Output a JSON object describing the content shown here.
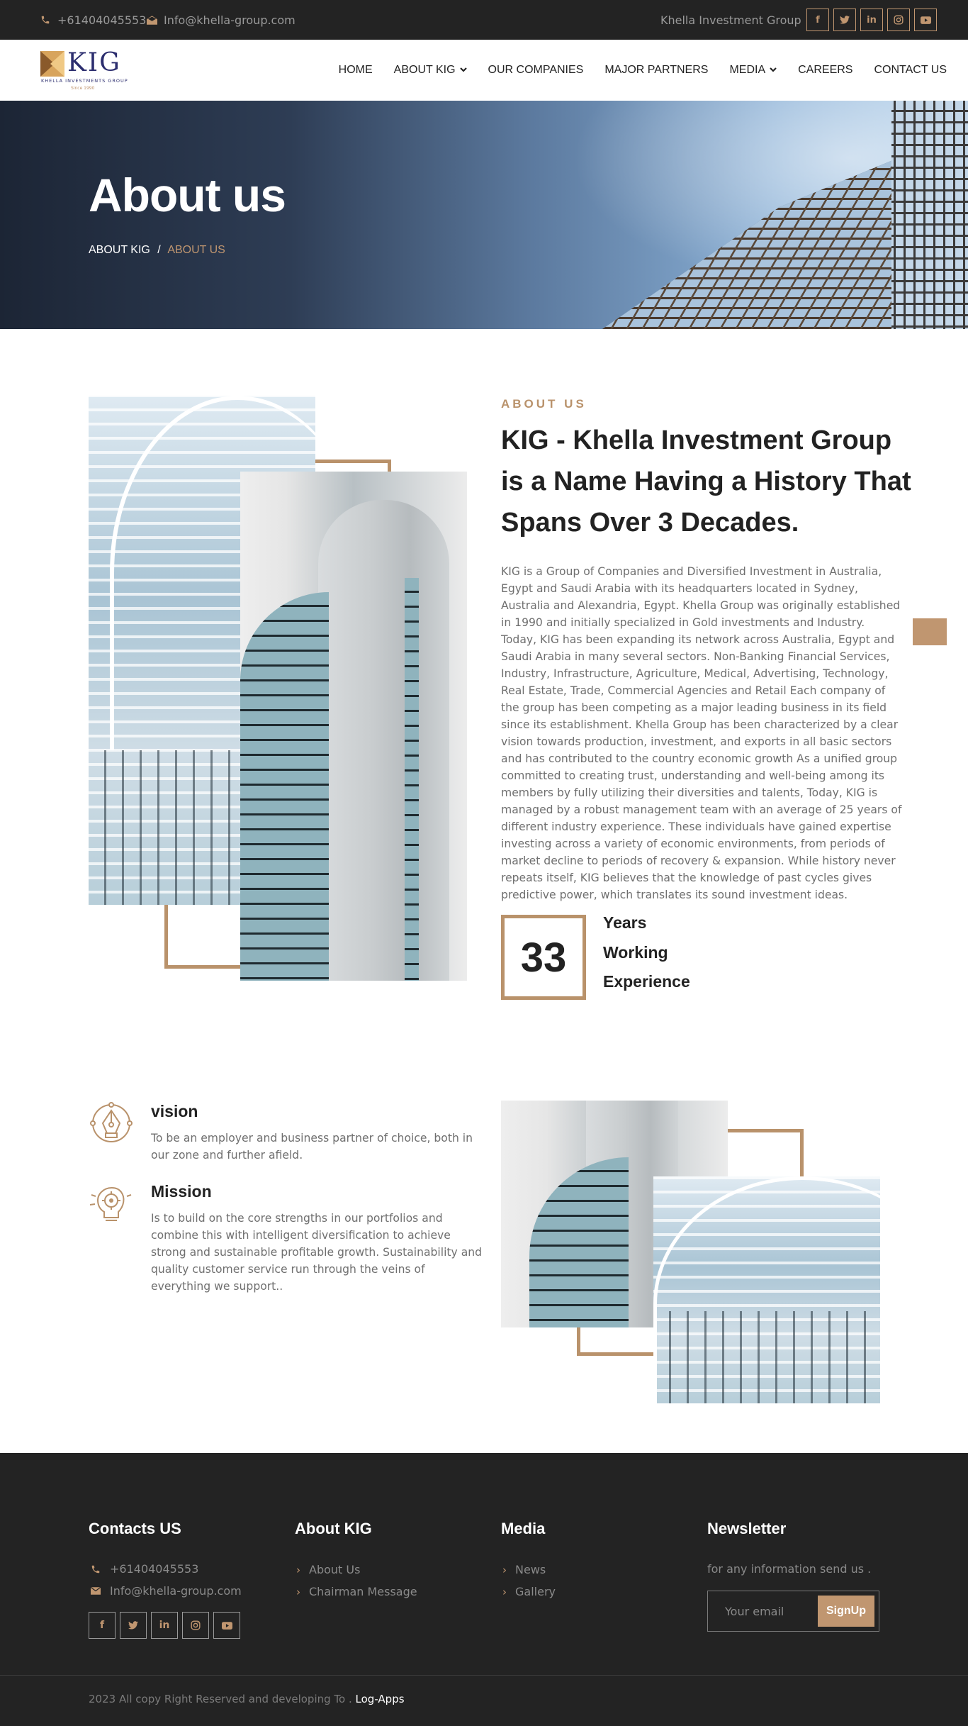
{
  "topbar": {
    "phone": "+61404045553",
    "email": "Info@khella-group.com",
    "brand": "Khella Investment Group"
  },
  "logo": {
    "text": "KIG",
    "subtitle": "KHELLA INVESTMENTS GROUP",
    "since": "Since 1990"
  },
  "nav": {
    "items": [
      "HOME",
      "ABOUT KIG",
      "OUR COMPANIES",
      "MAJOR PARTNERS",
      "MEDIA",
      "CAREERS",
      "CONTACT US"
    ]
  },
  "hero": {
    "title": "About us",
    "crumb_parent": "ABOUT KIG",
    "crumb_sep": "/",
    "crumb_current": "ABOUT US"
  },
  "about": {
    "kicker": "ABOUT US",
    "heading_lines": [
      "KIG - Khella Investment Group",
      "is a Name Having a History That",
      "Spans Over 3 Decades."
    ],
    "paragraph_lines": [
      "KIG is a Group of Companies and Diversified Investment in Australia,",
      "Egypt and Saudi Arabia with its headquarters located in Sydney,",
      "Australia and Alexandria, Egypt. Khella Group was originally established",
      "in 1990 and initially specialized in Gold investments and Industry.",
      "Today, KIG has been expanding its network across Australia, Egypt and",
      "Saudi Arabia in many several sectors. Non-Banking Financial Services,",
      "Industry, Infrastructure, Agriculture, Medical, Advertising, Technology,",
      "Real Estate, Trade, Commercial Agencies and Retail Each company of",
      "the group has been competing as a major leading business in its field",
      "since its establishment. Khella Group has been characterized by a clear",
      "vision towards production, investment, and exports in all basic sectors",
      "and has contributed to the country economic growth As a unified group",
      "committed to creating trust, understanding and well-being among its",
      "members by fully utilizing their diversities and talents, Today, KIG is",
      "managed by a robust management team with an average of 25 years of",
      "different industry experience. These individuals have gained expertise",
      "investing across a variety of economic environments, from periods of",
      "market decline to periods of recovery & expansion. While history never",
      "repeats itself, KIG believes that the knowledge of past cycles gives",
      "predictive power, which translates its sound investment ideas."
    ],
    "experience_number": "33",
    "experience_lines": [
      "Years",
      "Working",
      "Experience"
    ]
  },
  "vision": {
    "title": "vision",
    "text_lines": [
      "To be an employer and business partner of choice, both in",
      "our zone and further afield."
    ]
  },
  "mission": {
    "title": "Mission",
    "text_lines": [
      "Is to build on the core strengths in our portfolios and",
      "combine this with intelligent diversification to achieve",
      "strong and sustainable profitable growth. Sustainability and",
      "quality customer service run through the veins of",
      "everything we support.."
    ]
  },
  "footer": {
    "contacts_title": "Contacts US",
    "phone": "+61404045553",
    "email": "Info@khella-group.com",
    "about_title": "About KIG",
    "about_links": [
      "About Us",
      "Chairman Message"
    ],
    "media_title": "Media",
    "media_links": [
      "News",
      "Gallery"
    ],
    "newsletter_title": "Newsletter",
    "newsletter_text": "for any information send us .",
    "email_placeholder": "Your email",
    "signup_label": "SignUp",
    "copyright": "2023 All copy Right Reserved and developing To .",
    "copyright_link": "Log-Apps"
  },
  "social_icons": [
    "facebook-icon",
    "twitter-icon",
    "linkedin-icon",
    "instagram-icon",
    "youtube-icon"
  ],
  "colors": {
    "accent": "#c09670",
    "dark": "#232323",
    "text": "#222222",
    "muted": "#6f6f6f"
  }
}
